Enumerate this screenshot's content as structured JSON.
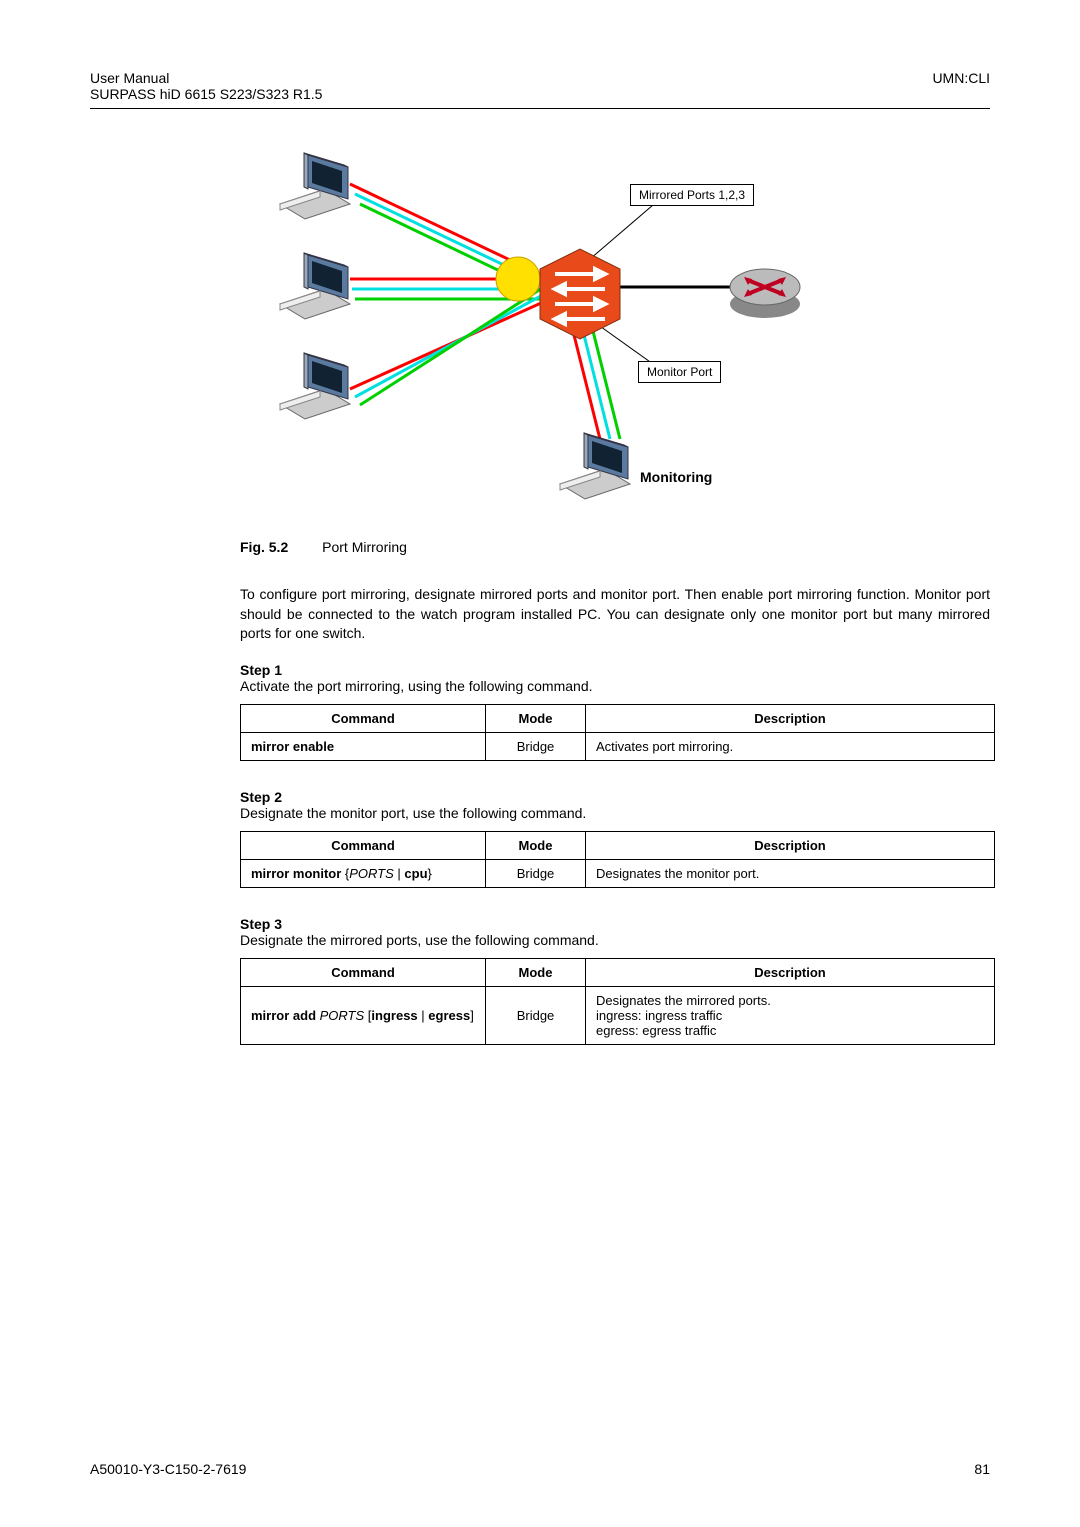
{
  "header": {
    "left1": "User  Manual",
    "left2": "SURPASS hiD 6615 S223/S323 R1.5",
    "right": "UMN:CLI"
  },
  "diagram": {
    "mirrored_label": "Mirrored Ports 1,2,3",
    "monitor_label": "Monitor Port",
    "monitoring": "Monitoring"
  },
  "caption": {
    "fig": "Fig. 5.2",
    "title": "Port Mirroring"
  },
  "intro": "To configure port mirroring, designate mirrored ports and monitor port. Then enable port mirroring function. Monitor port should be connected to the watch program installed PC. You can designate only one monitor port but many mirrored ports for one switch.",
  "step1": {
    "heading": "Step 1",
    "text": "Activate the port mirroring, using the following command.",
    "th_cmd": "Command",
    "th_mode": "Mode",
    "th_desc": "Description",
    "cmd": "mirror enable",
    "mode": "Bridge",
    "desc": "Activates port mirroring."
  },
  "step2": {
    "heading": "Step 2",
    "text": "Designate the monitor port, use the following command.",
    "th_cmd": "Command",
    "th_mode": "Mode",
    "th_desc": "Description",
    "cmd_prefix": "mirror monitor ",
    "cmd_brace_open": "{",
    "cmd_ports": "PORTS",
    "cmd_pipe": " | ",
    "cmd_cpu": "cpu",
    "cmd_brace_close": "}",
    "mode": "Bridge",
    "desc": "Designates the monitor port."
  },
  "step3": {
    "heading": "Step 3",
    "text": "Designate the mirrored ports, use the following command.",
    "th_cmd": "Command",
    "th_mode": "Mode",
    "th_desc": "Description",
    "cmd_prefix": "mirror add ",
    "cmd_ports": "PORTS",
    "cmd_open": " [",
    "cmd_ingress": "ingress",
    "cmd_pipe": " | ",
    "cmd_egress": "egress",
    "cmd_close": "]",
    "mode": "Bridge",
    "desc_l1": "Designates the mirrored ports.",
    "desc_l2": "ingress: ingress traffic",
    "desc_l3": "egress: egress traffic"
  },
  "footer": {
    "left": "A50010-Y3-C150-2-7619",
    "right": "81"
  }
}
